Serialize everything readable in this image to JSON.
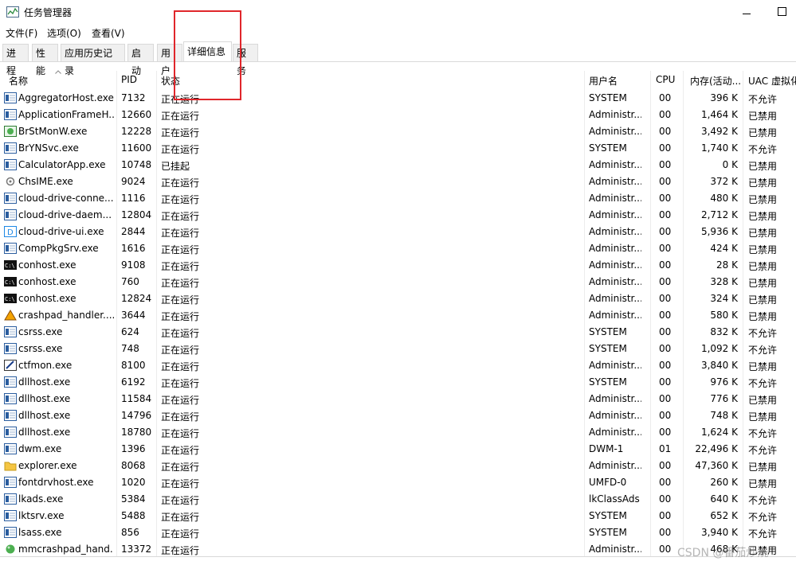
{
  "window": {
    "title": "任务管理器"
  },
  "menu": [
    "文件(F)",
    "选项(O)",
    "查看(V)"
  ],
  "tabs": [
    {
      "label": "进程",
      "active": false
    },
    {
      "label": "性能",
      "active": false
    },
    {
      "label": "应用历史记录",
      "active": false
    },
    {
      "label": "启动",
      "active": false
    },
    {
      "label": "用户",
      "active": false
    },
    {
      "label": "详细信息",
      "active": true
    },
    {
      "label": "服务",
      "active": false
    }
  ],
  "columns": {
    "name": "名称",
    "pid": "PID",
    "status": "状态",
    "user": "用户名",
    "cpu": "CPU",
    "memory": "内存(活动...",
    "uac": "UAC 虚拟化"
  },
  "accent": "#e0262b",
  "rows": [
    {
      "icon": "app",
      "name": "AggregatorHost.exe",
      "pid": "7132",
      "status": "正在运行",
      "user": "SYSTEM",
      "cpu": "00",
      "mem": "396 K",
      "uac": "不允许"
    },
    {
      "icon": "app",
      "name": "ApplicationFrameH...",
      "pid": "12660",
      "status": "正在运行",
      "user": "Administr...",
      "cpu": "00",
      "mem": "1,464 K",
      "uac": "已禁用"
    },
    {
      "icon": "green",
      "name": "BrStMonW.exe",
      "pid": "12228",
      "status": "正在运行",
      "user": "Administr...",
      "cpu": "00",
      "mem": "3,492 K",
      "uac": "已禁用"
    },
    {
      "icon": "app",
      "name": "BrYNSvc.exe",
      "pid": "11600",
      "status": "正在运行",
      "user": "SYSTEM",
      "cpu": "00",
      "mem": "1,740 K",
      "uac": "不允许"
    },
    {
      "icon": "app",
      "name": "CalculatorApp.exe",
      "pid": "10748",
      "status": "已挂起",
      "user": "Administr...",
      "cpu": "00",
      "mem": "0 K",
      "uac": "已禁用"
    },
    {
      "icon": "gear",
      "name": "ChsIME.exe",
      "pid": "9024",
      "status": "正在运行",
      "user": "Administr...",
      "cpu": "00",
      "mem": "372 K",
      "uac": "已禁用"
    },
    {
      "icon": "app",
      "name": "cloud-drive-conne...",
      "pid": "1116",
      "status": "正在运行",
      "user": "Administr...",
      "cpu": "00",
      "mem": "480 K",
      "uac": "已禁用"
    },
    {
      "icon": "app",
      "name": "cloud-drive-daem...",
      "pid": "12804",
      "status": "正在运行",
      "user": "Administr...",
      "cpu": "00",
      "mem": "2,712 K",
      "uac": "已禁用"
    },
    {
      "icon": "blued",
      "name": "cloud-drive-ui.exe",
      "pid": "2844",
      "status": "正在运行",
      "user": "Administr...",
      "cpu": "00",
      "mem": "5,936 K",
      "uac": "已禁用"
    },
    {
      "icon": "app",
      "name": "CompPkgSrv.exe",
      "pid": "1616",
      "status": "正在运行",
      "user": "Administr...",
      "cpu": "00",
      "mem": "424 K",
      "uac": "已禁用"
    },
    {
      "icon": "console",
      "name": "conhost.exe",
      "pid": "9108",
      "status": "正在运行",
      "user": "Administr...",
      "cpu": "00",
      "mem": "28 K",
      "uac": "已禁用"
    },
    {
      "icon": "console",
      "name": "conhost.exe",
      "pid": "760",
      "status": "正在运行",
      "user": "Administr...",
      "cpu": "00",
      "mem": "328 K",
      "uac": "已禁用"
    },
    {
      "icon": "console",
      "name": "conhost.exe",
      "pid": "12824",
      "status": "正在运行",
      "user": "Administr...",
      "cpu": "00",
      "mem": "324 K",
      "uac": "已禁用"
    },
    {
      "icon": "crash",
      "name": "crashpad_handler....",
      "pid": "3644",
      "status": "正在运行",
      "user": "Administr...",
      "cpu": "00",
      "mem": "580 K",
      "uac": "已禁用"
    },
    {
      "icon": "app",
      "name": "csrss.exe",
      "pid": "624",
      "status": "正在运行",
      "user": "SYSTEM",
      "cpu": "00",
      "mem": "832 K",
      "uac": "不允许"
    },
    {
      "icon": "app",
      "name": "csrss.exe",
      "pid": "748",
      "status": "正在运行",
      "user": "SYSTEM",
      "cpu": "00",
      "mem": "1,092 K",
      "uac": "不允许"
    },
    {
      "icon": "pen",
      "name": "ctfmon.exe",
      "pid": "8100",
      "status": "正在运行",
      "user": "Administr...",
      "cpu": "00",
      "mem": "3,840 K",
      "uac": "已禁用"
    },
    {
      "icon": "app",
      "name": "dllhost.exe",
      "pid": "6192",
      "status": "正在运行",
      "user": "SYSTEM",
      "cpu": "00",
      "mem": "976 K",
      "uac": "不允许"
    },
    {
      "icon": "app",
      "name": "dllhost.exe",
      "pid": "11584",
      "status": "正在运行",
      "user": "Administr...",
      "cpu": "00",
      "mem": "776 K",
      "uac": "已禁用"
    },
    {
      "icon": "app",
      "name": "dllhost.exe",
      "pid": "14796",
      "status": "正在运行",
      "user": "Administr...",
      "cpu": "00",
      "mem": "748 K",
      "uac": "已禁用"
    },
    {
      "icon": "app",
      "name": "dllhost.exe",
      "pid": "18780",
      "status": "正在运行",
      "user": "Administr...",
      "cpu": "00",
      "mem": "1,624 K",
      "uac": "不允许"
    },
    {
      "icon": "app",
      "name": "dwm.exe",
      "pid": "1396",
      "status": "正在运行",
      "user": "DWM-1",
      "cpu": "01",
      "mem": "22,496 K",
      "uac": "不允许"
    },
    {
      "icon": "folder",
      "name": "explorer.exe",
      "pid": "8068",
      "status": "正在运行",
      "user": "Administr...",
      "cpu": "00",
      "mem": "47,360 K",
      "uac": "已禁用"
    },
    {
      "icon": "app",
      "name": "fontdrvhost.exe",
      "pid": "1020",
      "status": "正在运行",
      "user": "UMFD-0",
      "cpu": "00",
      "mem": "260 K",
      "uac": "已禁用"
    },
    {
      "icon": "app",
      "name": "lkads.exe",
      "pid": "5384",
      "status": "正在运行",
      "user": "lkClassAds",
      "cpu": "00",
      "mem": "640 K",
      "uac": "不允许"
    },
    {
      "icon": "app",
      "name": "lktsrv.exe",
      "pid": "5488",
      "status": "正在运行",
      "user": "SYSTEM",
      "cpu": "00",
      "mem": "652 K",
      "uac": "不允许"
    },
    {
      "icon": "app",
      "name": "lsass.exe",
      "pid": "856",
      "status": "正在运行",
      "user": "SYSTEM",
      "cpu": "00",
      "mem": "3,940 K",
      "uac": "不允许"
    },
    {
      "icon": "greenball",
      "name": "mmcrashpad_hand...",
      "pid": "13372",
      "status": "正在运行",
      "user": "Administr...",
      "cpu": "00",
      "mem": "468 K",
      "uac": "已禁用"
    }
  ],
  "watermark": "CSDN @番茄炒烧"
}
